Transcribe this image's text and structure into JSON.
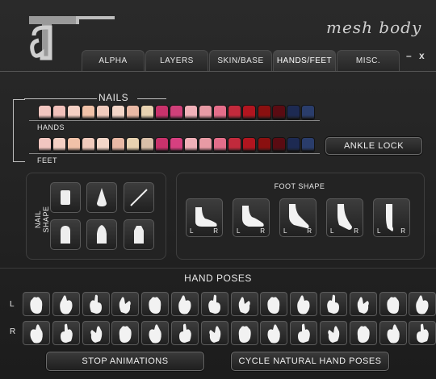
{
  "window": {
    "brand": "mesh body",
    "minimize": "–",
    "close": "x"
  },
  "tabs": [
    {
      "label": "ALPHA",
      "active": false
    },
    {
      "label": "LAYERS",
      "active": false
    },
    {
      "label": "SKIN/BASE",
      "active": false
    },
    {
      "label": "HANDS/FEET",
      "active": true
    },
    {
      "label": "MISC.",
      "active": false
    }
  ],
  "nails": {
    "title": "NAILS",
    "hands_label": "HANDS",
    "feet_label": "FEET",
    "ankle_lock": "ANKLE LOCK",
    "hand_colors": [
      "#f2c6c0",
      "#f0c0ba",
      "#f4d0c4",
      "#f1c2a8",
      "#f0cbbd",
      "#f3d6c8",
      "#e9b9a5",
      "#e8d2b0",
      "#c8326b",
      "#d0407a",
      "#f0b0b8",
      "#e79aa4",
      "#e46e8a",
      "#c22a3c",
      "#b1151f",
      "#8a1010",
      "#5a0b12",
      "#1d2a52",
      "#2a3d6b"
    ],
    "feet_colors": [
      "#f2c6c0",
      "#f4d0c4",
      "#f1c2a8",
      "#f0cbbd",
      "#f3d6c8",
      "#e9b9a5",
      "#e8d2b0",
      "#d8bfa8",
      "#c8326b",
      "#d64080",
      "#f0b0b8",
      "#e79aa4",
      "#e46e8a",
      "#c22a3c",
      "#b1151f",
      "#8a1010",
      "#5a0b12",
      "#1d2a52",
      "#2a3d6b"
    ]
  },
  "nail_shape": {
    "label": "NAIL SHAPE",
    "shapes": [
      "square-nail-icon",
      "stiletto-nail-icon",
      "slash-nail-icon",
      "round-nail-icon",
      "almond-nail-icon",
      "coffin-nail-icon"
    ]
  },
  "foot_shape": {
    "label": "FOOT SHAPE",
    "options": [
      {
        "name": "flat-foot-icon",
        "l": "L",
        "r": "R"
      },
      {
        "name": "low-heel-foot-icon",
        "l": "L",
        "r": "R"
      },
      {
        "name": "mid-heel-foot-icon",
        "l": "L",
        "r": "R"
      },
      {
        "name": "high-heel-foot-icon",
        "l": "L",
        "r": "R"
      },
      {
        "name": "tiptoe-foot-icon",
        "l": "L",
        "r": "R"
      }
    ]
  },
  "hand_poses": {
    "title": "HAND POSES",
    "left_label": "L",
    "right_label": "R",
    "count_per_row": 14,
    "stop": "STOP ANIMATIONS",
    "cycle": "CYCLE NATURAL HAND POSES"
  }
}
